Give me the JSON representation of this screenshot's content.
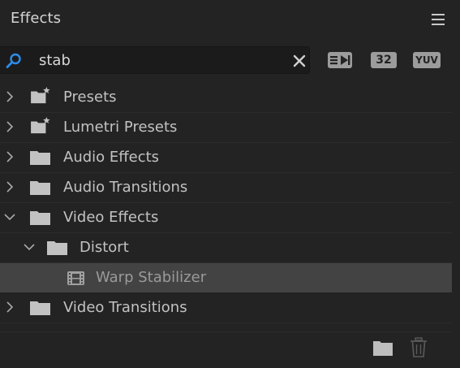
{
  "panel": {
    "title": "Effects",
    "menu_icon": "hamburger-icon"
  },
  "search": {
    "value": "stab",
    "search_icon": "search-icon",
    "clear_icon": "close-icon"
  },
  "filters": [
    {
      "name": "accelerated-effects-filter",
      "label": "",
      "icon": "accelerated-effects-icon"
    },
    {
      "name": "32-bit-filter",
      "label": "32",
      "icon": "32-bit-icon"
    },
    {
      "name": "yuv-filter",
      "label": "YUV",
      "icon": "yuv-icon"
    }
  ],
  "tree": {
    "items": [
      {
        "label": "Presets",
        "expanded": false,
        "type": "preset-folder",
        "level": 0
      },
      {
        "label": "Lumetri Presets",
        "expanded": false,
        "type": "preset-folder",
        "level": 0
      },
      {
        "label": "Audio Effects",
        "expanded": false,
        "type": "folder",
        "level": 0
      },
      {
        "label": "Audio Transitions",
        "expanded": false,
        "type": "folder",
        "level": 0
      },
      {
        "label": "Video Effects",
        "expanded": true,
        "type": "folder",
        "level": 0
      },
      {
        "label": "Distort",
        "expanded": true,
        "type": "folder",
        "level": 1
      },
      {
        "label": "Warp Stabilizer",
        "selected": true,
        "type": "effect",
        "level": 2
      },
      {
        "label": "Video Transitions",
        "expanded": false,
        "type": "folder",
        "level": 0
      }
    ]
  },
  "footer": {
    "new_bin_icon": "new-folder-icon",
    "delete_icon": "trash-icon"
  },
  "colors": {
    "panel_bg": "#232323",
    "search_bg": "#1b1b1b",
    "selected_row": "#434343",
    "search_icon": "#2d8ceb",
    "text": "#c2c2c2"
  }
}
